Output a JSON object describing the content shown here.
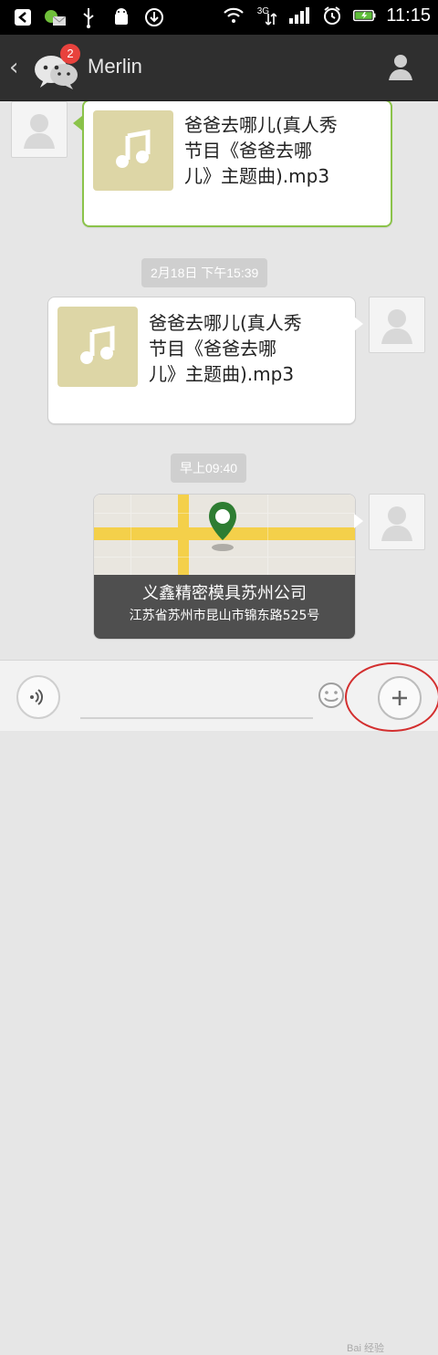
{
  "status_bar": {
    "time": "11:15",
    "network_label": "3G",
    "icons": [
      "back-arrow-icon",
      "mail-icon",
      "usb-icon",
      "android-icon",
      "download-icon",
      "wifi-icon",
      "signal-3g-icon",
      "signal-bars-icon",
      "alarm-icon",
      "battery-charging-icon"
    ]
  },
  "header": {
    "back_icon": "chevron-left-icon",
    "app_icon": "wechat-icon",
    "unread_badge": "2",
    "title": "Merlin",
    "profile_icon": "profile-icon"
  },
  "messages": [
    {
      "type": "audio_file",
      "direction": "incoming",
      "text": "爸爸去哪儿(真人秀\n节目《爸爸去哪\n儿》主题曲).mp3"
    },
    {
      "type": "timestamp",
      "text": "2月18日 下午15:39"
    },
    {
      "type": "audio_file",
      "direction": "outgoing",
      "text": "爸爸去哪儿(真人秀\n节目《爸爸去哪\n儿》主题曲).mp3"
    },
    {
      "type": "timestamp",
      "text": "早上09:40"
    },
    {
      "type": "location",
      "direction": "outgoing",
      "title": "义鑫精密模具苏州公司",
      "address": "江苏省苏州市昆山市锦东路525号"
    }
  ],
  "input_bar": {
    "voice_icon": "voice-icon",
    "emoji_icon": "emoji-icon",
    "plus_icon": "plus-icon"
  },
  "watermark": "Bai 经验"
}
